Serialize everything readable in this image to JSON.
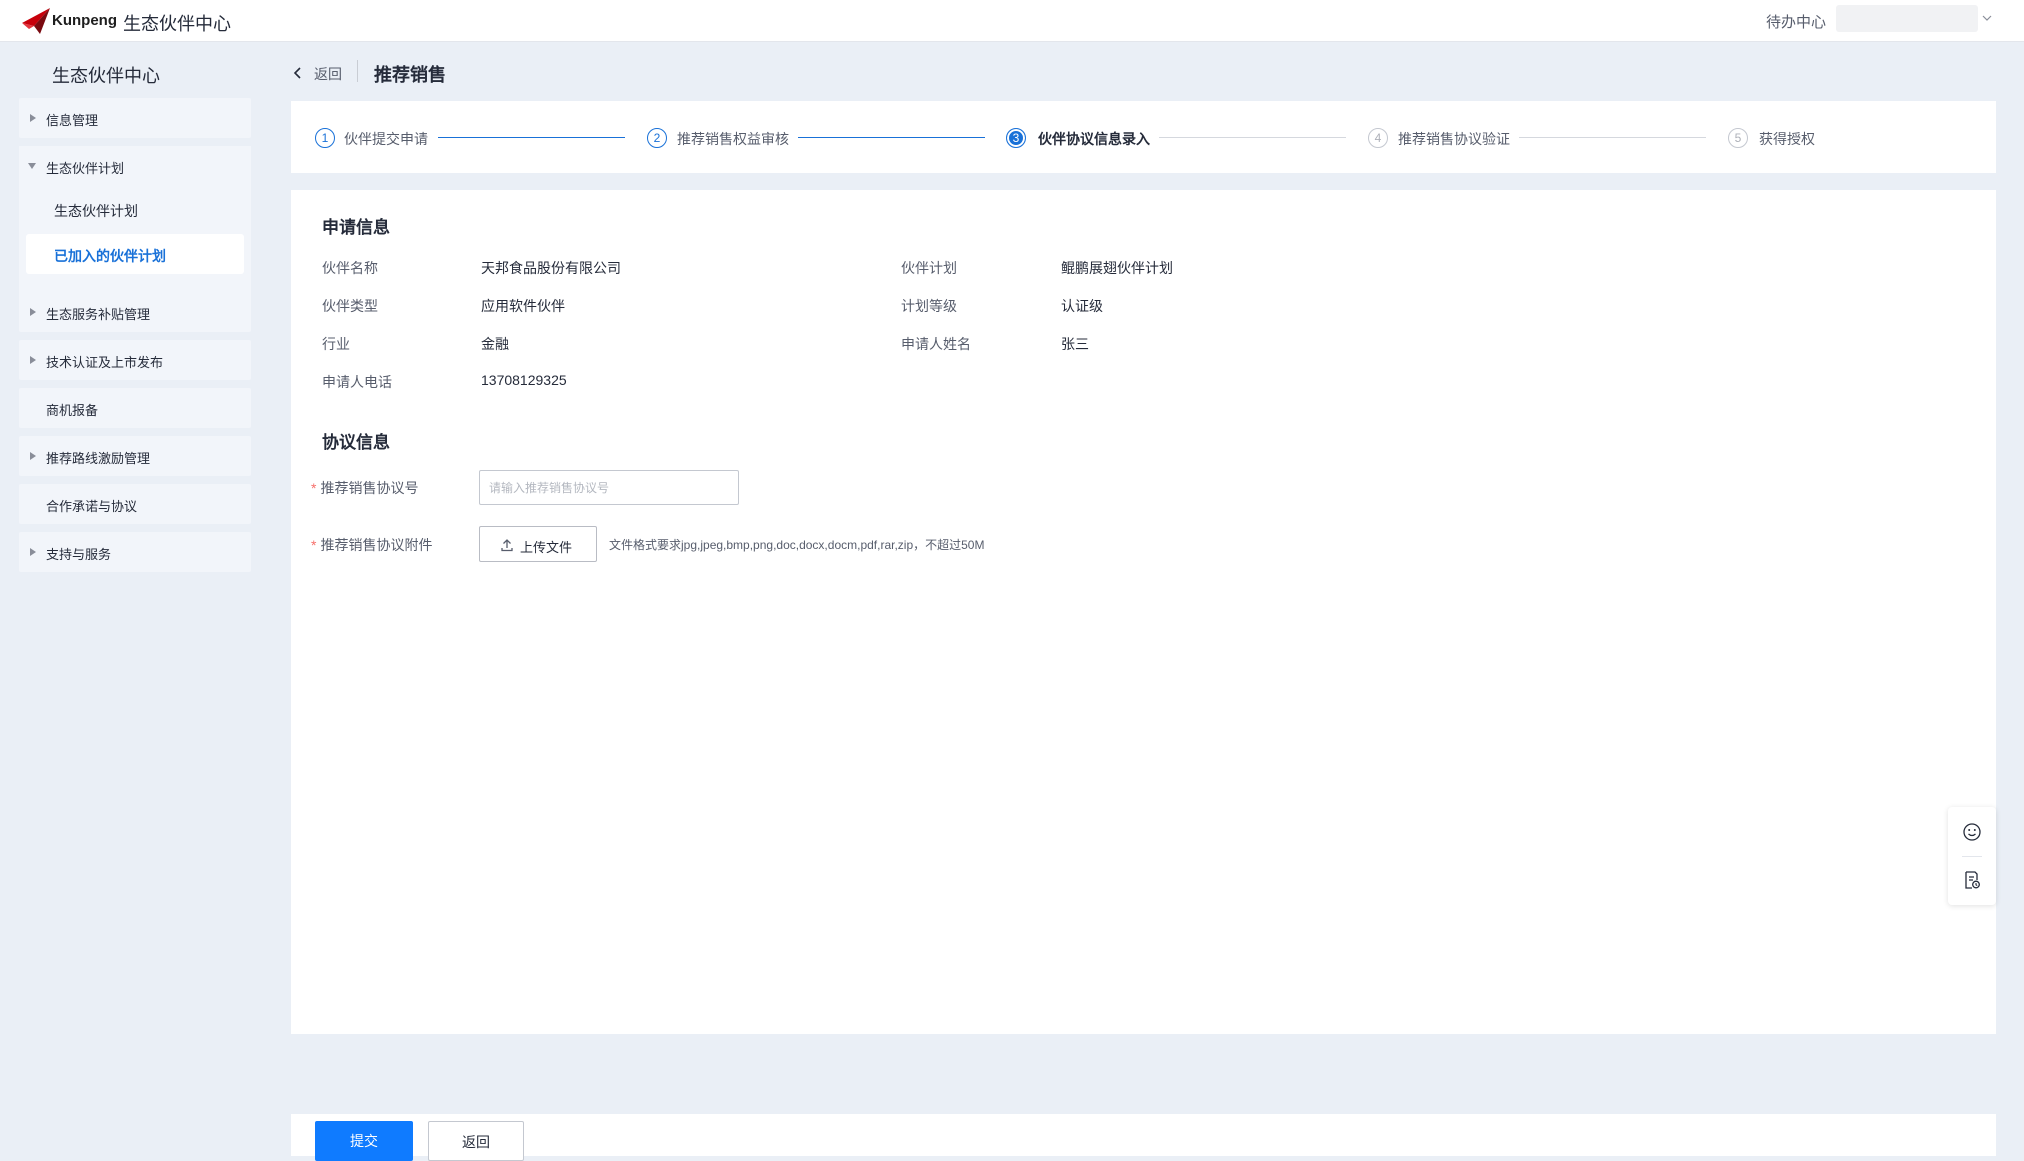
{
  "topbar": {
    "brand": "Kunpeng",
    "app_title": "生态伙伴中心",
    "todo_center": "待办中心"
  },
  "sidebar": {
    "title": "生态伙伴中心",
    "items": [
      {
        "label": "信息管理"
      },
      {
        "label": "生态伙伴计划",
        "children": [
          {
            "label": "生态伙伴计划"
          },
          {
            "label": "已加入的伙伴计划",
            "active": true
          }
        ]
      },
      {
        "label": "生态服务补贴管理"
      },
      {
        "label": "技术认证及上市发布"
      },
      {
        "label": "商机报备"
      },
      {
        "label": "推荐路线激励管理"
      },
      {
        "label": "合作承诺与协议"
      },
      {
        "label": "支持与服务"
      }
    ]
  },
  "header": {
    "back_label": "返回",
    "page_title": "推荐销售"
  },
  "steps": [
    {
      "num": "1",
      "label": "伙伴提交申请",
      "status": "done"
    },
    {
      "num": "2",
      "label": "推荐销售权益审核",
      "status": "done"
    },
    {
      "num": "3",
      "label": "伙伴协议信息录入",
      "status": "active"
    },
    {
      "num": "4",
      "label": "推荐销售协议验证",
      "status": "todo"
    },
    {
      "num": "5",
      "label": "获得授权",
      "status": "todo"
    }
  ],
  "application": {
    "title": "申请信息",
    "fields": {
      "partner_name": {
        "label": "伙伴名称",
        "value": "天邦食品股份有限公司"
      },
      "partner_plan": {
        "label": "伙伴计划",
        "value": "鲲鹏展翅伙伴计划"
      },
      "partner_type": {
        "label": "伙伴类型",
        "value": "应用软件伙伴"
      },
      "plan_level": {
        "label": "计划等级",
        "value": "认证级"
      },
      "industry": {
        "label": "行业",
        "value": "金融"
      },
      "applicant_name": {
        "label": "申请人姓名",
        "value": "张三"
      },
      "applicant_phone": {
        "label": "申请人电话",
        "value": "13708129325"
      }
    }
  },
  "agreement": {
    "title": "协议信息",
    "required_mark": "*",
    "number_label": "推荐销售协议号",
    "number_value": "",
    "number_placeholder": "请输入推荐销售协议号",
    "attachment_label": "推荐销售协议附件",
    "upload_label": "上传文件",
    "upload_hint": "文件格式要求jpg,jpeg,bmp,png,doc,docx,docm,pdf,rar,zip，不超过50M"
  },
  "footer": {
    "submit_label": "提交",
    "back_label": "返回"
  },
  "colors": {
    "primary": "#0f7bff",
    "active_text": "#1971d8",
    "required": "#f66f6a",
    "page_bg": "#eaeff6"
  },
  "icons": {
    "logo": "kunpeng-logo-icon",
    "float_1": "smiley-icon",
    "float_2": "feedback-form-icon"
  }
}
